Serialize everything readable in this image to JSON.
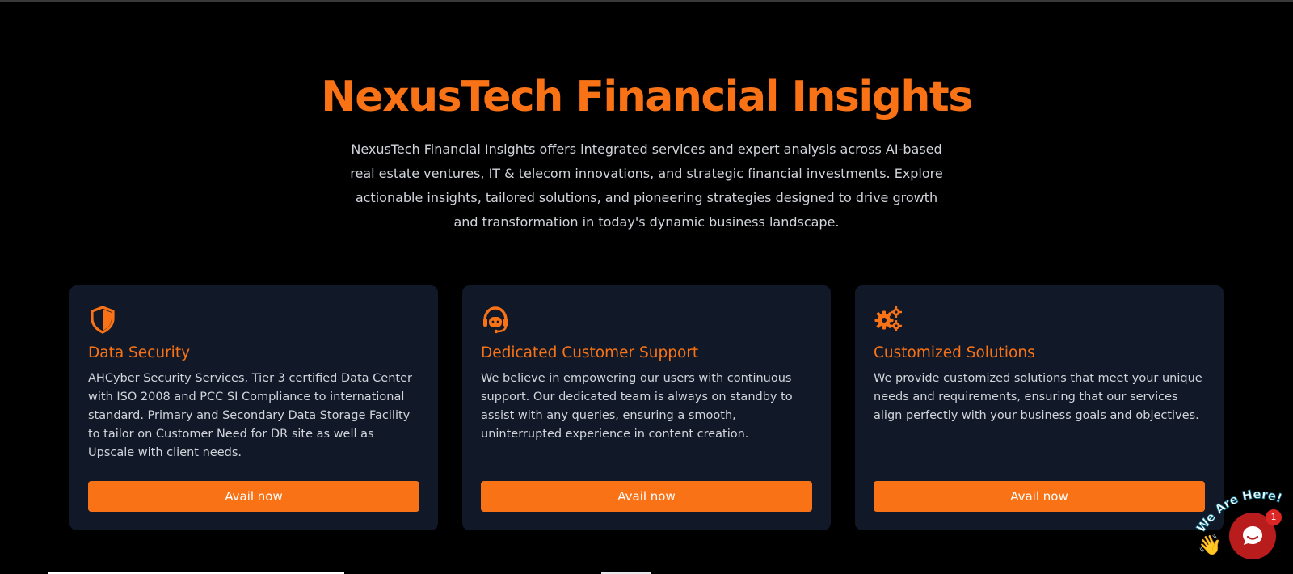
{
  "hero": {
    "title": "NexusTech Financial Insights",
    "description": "NexusTech Financial Insights offers integrated services and expert analysis across AI-based real estate ventures, IT & telecom innovations, and strategic financial investments. Explore actionable insights, tailored solutions, and pioneering strategies designed to drive growth and transformation in today's dynamic business landscape."
  },
  "cards": [
    {
      "icon": "shield-icon",
      "title": "Data Security",
      "description": "AHCyber Security Services, Tier 3 certified Data Center with ISO 2008 and PCC SI Compliance to international standard. Primary and Secondary Data Storage Facility to tailor on Customer Need for DR site as well as Upscale with client needs.",
      "button_label": "Avail now"
    },
    {
      "icon": "headset-icon",
      "title": "Dedicated Customer Support",
      "description": "We believe in empowering our users with continuous support. Our dedicated team is always on standby to assist with any queries, ensuring a smooth, uninterrupted experience in content creation.",
      "button_label": "Avail now"
    },
    {
      "icon": "gears-icon",
      "title": "Customized Solutions",
      "description": "We provide customized solutions that meet your unique needs and requirements, ensuring that our services align perfectly with your business goals and objectives.",
      "button_label": "Avail now"
    }
  ],
  "chat_widget": {
    "sticker_text": "We Are Here!",
    "badge_count": "1",
    "icon": "chat-bubble-icon",
    "hand_icon": "waving-hand-icon"
  },
  "colors": {
    "accent": "#f97316",
    "background": "#000000",
    "card_background": "#111827",
    "body_text": "#d1d5db",
    "chat_red": "#b91c1c"
  }
}
